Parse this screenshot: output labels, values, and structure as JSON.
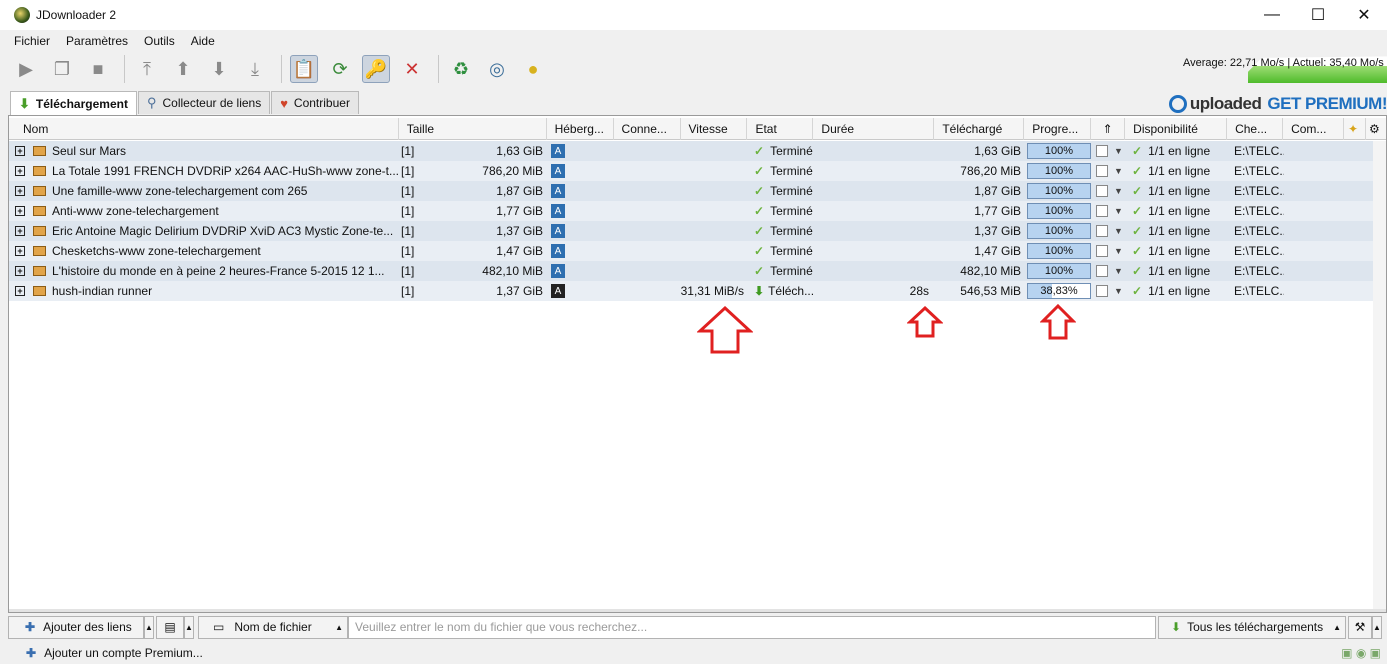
{
  "window": {
    "title": "JDownloader 2",
    "minimize": "—",
    "maximize": "☐",
    "close": "✕"
  },
  "menu": [
    "Fichier",
    "Paramètres",
    "Outils",
    "Aide"
  ],
  "speed": {
    "text": "Average: 22,71 Mo/s | Actuel: 35,40 Mo/s"
  },
  "tabs": [
    {
      "label": "Téléchargement",
      "icon": "download-arrow-icon"
    },
    {
      "label": "Collecteur de liens",
      "icon": "link-grabber-icon"
    },
    {
      "label": "Contribuer",
      "icon": "heart-icon"
    }
  ],
  "premium": {
    "brand": "uploaded",
    "cta": "GET PREMIUM!"
  },
  "columns": [
    "Nom",
    "Taille",
    "Héberg...",
    "Conne...",
    "Vitesse",
    "Etat",
    "Durée",
    "Téléchargé",
    "Progre...",
    "",
    "Disponibilité",
    "Che...",
    "Com..."
  ],
  "rows": [
    {
      "name": "Seul sur Mars",
      "count": "[1]",
      "size": "1,63 GiB",
      "speed": "",
      "state": "Terminé",
      "duration": "",
      "downloaded": "1,63 GiB",
      "progress": "100%",
      "progress_value": 100,
      "availability": "1/1 en ligne",
      "path": "E:\\TELC..."
    },
    {
      "name": "La Totale 1991 FRENCH DVDRiP x264 AAC-HuSh-www zone-t...",
      "count": "[1]",
      "size": "786,20 MiB",
      "speed": "",
      "state": "Terminé",
      "duration": "",
      "downloaded": "786,20 MiB",
      "progress": "100%",
      "progress_value": 100,
      "availability": "1/1 en ligne",
      "path": "E:\\TELC..."
    },
    {
      "name": "Une famille-www zone-telechargement com 265",
      "count": "[1]",
      "size": "1,87 GiB",
      "speed": "",
      "state": "Terminé",
      "duration": "",
      "downloaded": "1,87 GiB",
      "progress": "100%",
      "progress_value": 100,
      "availability": "1/1 en ligne",
      "path": "E:\\TELC..."
    },
    {
      "name": "Anti-www zone-telechargement",
      "count": "[1]",
      "size": "1,77 GiB",
      "speed": "",
      "state": "Terminé",
      "duration": "",
      "downloaded": "1,77 GiB",
      "progress": "100%",
      "progress_value": 100,
      "availability": "1/1 en ligne",
      "path": "E:\\TELC..."
    },
    {
      "name": "Eric Antoine Magic Delirium DVDRiP XviD AC3 Mystic Zone-te...",
      "count": "[1]",
      "size": "1,37 GiB",
      "speed": "",
      "state": "Terminé",
      "duration": "",
      "downloaded": "1,37 GiB",
      "progress": "100%",
      "progress_value": 100,
      "availability": "1/1 en ligne",
      "path": "E:\\TELC..."
    },
    {
      "name": "Chesketchs-www zone-telechargement",
      "count": "[1]",
      "size": "1,47 GiB",
      "speed": "",
      "state": "Terminé",
      "duration": "",
      "downloaded": "1,47 GiB",
      "progress": "100%",
      "progress_value": 100,
      "availability": "1/1 en ligne",
      "path": "E:\\TELC..."
    },
    {
      "name": "L'histoire du monde en à peine 2 heures-France 5-2015 12 1...",
      "count": "[1]",
      "size": "482,10 MiB",
      "speed": "",
      "state": "Terminé",
      "duration": "",
      "downloaded": "482,10 MiB",
      "progress": "100%",
      "progress_value": 100,
      "availability": "1/1 en ligne",
      "path": "E:\\TELC..."
    },
    {
      "name": "hush-indian runner",
      "count": "[1]",
      "size": "1,37 GiB",
      "speed": "31,31 MiB/s",
      "state": "Téléch...",
      "duration": "28s",
      "downloaded": "546,53 MiB",
      "progress": "38,83%",
      "progress_value": 38.83,
      "availability": "1/1 en ligne",
      "path": "E:\\TELC...",
      "downloading": true
    }
  ],
  "bottom": {
    "add_links": "Ajouter des liens",
    "filename_filter": "Nom de fichier",
    "search_placeholder": "Veuillez entrer le nom du fichier que vous recherchez...",
    "all_downloads": "Tous les téléchargements"
  },
  "status": {
    "add_premium": "Ajouter un compte Premium..."
  }
}
